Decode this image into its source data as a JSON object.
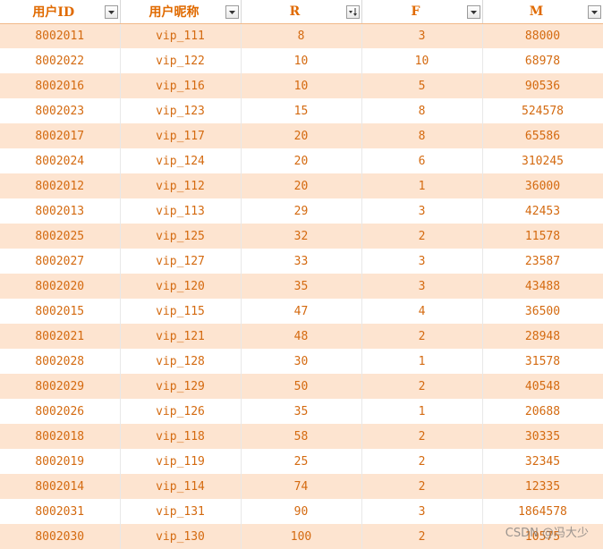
{
  "table": {
    "columns": [
      {
        "label": "用户ID",
        "filter": "dropdown"
      },
      {
        "label": "用户昵称",
        "filter": "dropdown"
      },
      {
        "label": "R",
        "filter": "sorted-ascending"
      },
      {
        "label": "F",
        "filter": "dropdown"
      },
      {
        "label": "M",
        "filter": "dropdown"
      }
    ],
    "rows": [
      [
        "8002011",
        "vip_111",
        "8",
        "3",
        "88000"
      ],
      [
        "8002022",
        "vip_122",
        "10",
        "10",
        "68978"
      ],
      [
        "8002016",
        "vip_116",
        "10",
        "5",
        "90536"
      ],
      [
        "8002023",
        "vip_123",
        "15",
        "8",
        "524578"
      ],
      [
        "8002017",
        "vip_117",
        "20",
        "8",
        "65586"
      ],
      [
        "8002024",
        "vip_124",
        "20",
        "6",
        "310245"
      ],
      [
        "8002012",
        "vip_112",
        "20",
        "1",
        "36000"
      ],
      [
        "8002013",
        "vip_113",
        "29",
        "3",
        "42453"
      ],
      [
        "8002025",
        "vip_125",
        "32",
        "2",
        "11578"
      ],
      [
        "8002027",
        "vip_127",
        "33",
        "3",
        "23587"
      ],
      [
        "8002020",
        "vip_120",
        "35",
        "3",
        "43488"
      ],
      [
        "8002015",
        "vip_115",
        "47",
        "4",
        "36500"
      ],
      [
        "8002021",
        "vip_121",
        "48",
        "2",
        "28948"
      ],
      [
        "8002028",
        "vip_128",
        "30",
        "1",
        "31578"
      ],
      [
        "8002029",
        "vip_129",
        "50",
        "2",
        "40548"
      ],
      [
        "8002026",
        "vip_126",
        "35",
        "1",
        "20688"
      ],
      [
        "8002018",
        "vip_118",
        "58",
        "2",
        "30335"
      ],
      [
        "8002019",
        "vip_119",
        "25",
        "2",
        "32345"
      ],
      [
        "8002014",
        "vip_114",
        "74",
        "2",
        "12335"
      ],
      [
        "8002031",
        "vip_131",
        "90",
        "3",
        "1864578"
      ],
      [
        "8002030",
        "vip_130",
        "100",
        "2",
        "10575"
      ]
    ]
  },
  "watermark": "CSDN @冯大少",
  "colors": {
    "header_text": "#e06a00",
    "cell_text": "#d46a10",
    "band_fill": "#fde4d0",
    "row_fill": "#ffffff"
  }
}
